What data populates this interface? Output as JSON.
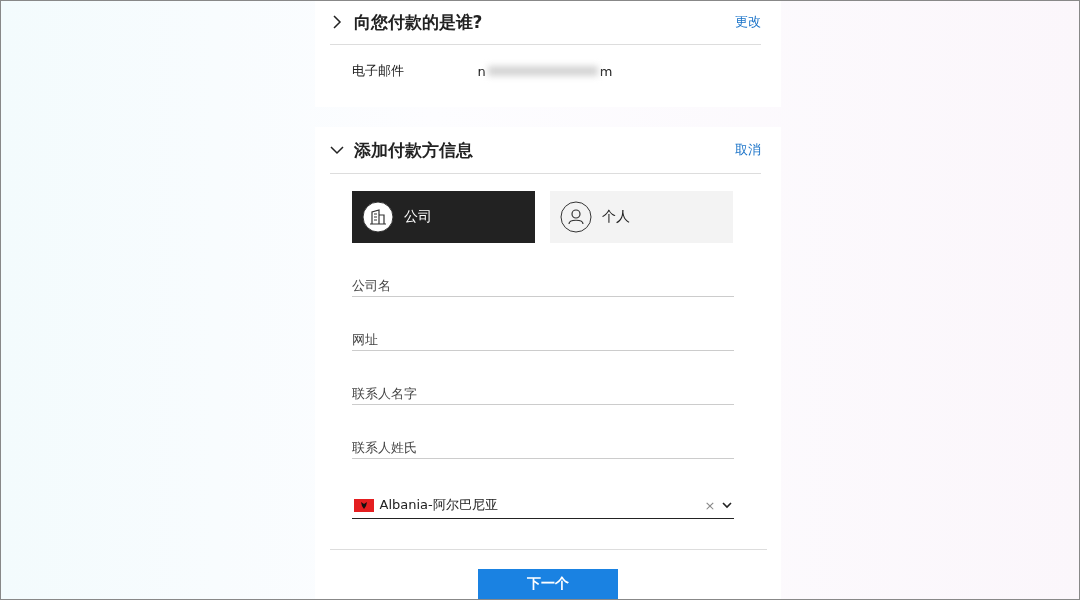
{
  "payer_section": {
    "title": "向您付款的是谁?",
    "expanded": false,
    "action": "更改",
    "email": {
      "label": "电子邮件",
      "value_start": "n",
      "value_end": "m"
    }
  },
  "payer_info_section": {
    "title": "添加付款方信息",
    "expanded": true,
    "action": "取消",
    "payer_types": [
      {
        "kind": "company",
        "label": "公司",
        "selected": true
      },
      {
        "kind": "person",
        "label": "个人",
        "selected": false
      }
    ],
    "fields": [
      {
        "placeholder": "公司名"
      },
      {
        "placeholder": "网址"
      },
      {
        "placeholder": "联系人名字"
      },
      {
        "placeholder": "联系人姓氏"
      }
    ],
    "country": {
      "value": "Albania-阿尔巴尼亚",
      "clear": "×"
    },
    "next_button": "下一个"
  }
}
